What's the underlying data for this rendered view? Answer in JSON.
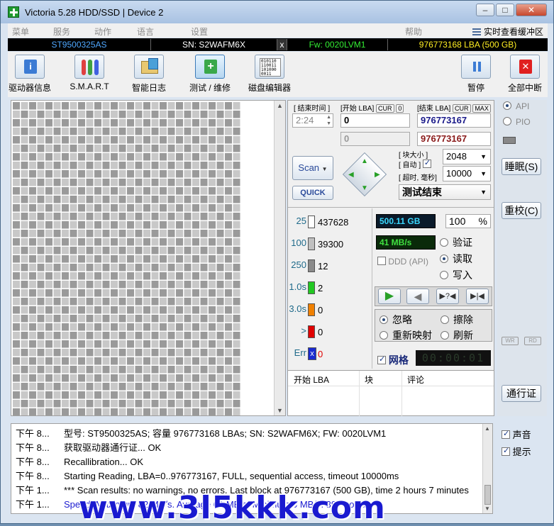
{
  "window": {
    "title": "Victoria 5.28 HDD/SSD | Device 2"
  },
  "menu": {
    "items": [
      "菜单",
      "服务",
      "动作",
      "语言",
      "设置",
      "帮助"
    ],
    "realtime_buffer": "实时查看缓冲区"
  },
  "drive": {
    "model": "ST9500325AS",
    "sn": "SN: S2WAFM6X",
    "x": "x",
    "fw": "Fw: 0020LVM1",
    "lba": "976773168 LBA (500 GB)"
  },
  "toolbar": {
    "buttons": [
      "驱动器信息",
      "S.M.A.R.T",
      "智能日志",
      "测试 / 维修",
      "磁盘编辑器"
    ],
    "pause": "暂停",
    "abort": "全部中断"
  },
  "scan": {
    "end_time_label": "[ 结束时间 ]",
    "start_lba_label": "[开始 LBA]",
    "end_lba_label": "[结束 LBA]",
    "cur": "CUR",
    "zero": "0",
    "max": "MAX",
    "end_time": "2:24",
    "start_lba": "0",
    "end_lba": "976773167",
    "cur_lba": "0",
    "cur_end_lba": "976773167",
    "scan_button": "Scan",
    "quick_button": "QUICK",
    "block_size_label": "[ 块大小 ]",
    "auto_label": "[ 自动 ]",
    "timeout_label": "[ 超时, 毫秒]",
    "block_size": "2048",
    "timeout": "10000",
    "status": "测试结束"
  },
  "stats": {
    "rows": [
      {
        "label": "25",
        "count": "437628",
        "color": "#ffffff"
      },
      {
        "label": "100",
        "count": "39300",
        "color": "#c0c0c0"
      },
      {
        "label": "250",
        "count": "12",
        "color": "#8a8a8a"
      },
      {
        "label": "1.0s",
        "count": "2",
        "color": "#22c822"
      },
      {
        "label": "3.0s",
        "count": "0",
        "color": "#f08000"
      },
      {
        "label": ">",
        "count": "0",
        "color": "#e00000"
      }
    ],
    "err_label": "Err",
    "err_count": "0",
    "size": "500.11 GB",
    "percent": "100",
    "percent_sign": "%",
    "speed": "41 MB/s",
    "ddd": "DDD (API)",
    "verify": "验证",
    "read": "读取",
    "write": "写入",
    "ignore": "忽略",
    "erase": "擦除",
    "remap": "重新映射",
    "refresh": "刷新",
    "grid": "网格",
    "timer": "00:00:01"
  },
  "table": {
    "col1": "开始 LBA",
    "col2": "块",
    "col3": "评论"
  },
  "side": {
    "api": "API",
    "pio": "PIO",
    "sleep": "睡眠(S)",
    "reset": "重校(C)",
    "wr": "WR",
    "rd": "RD",
    "passport": "通行证"
  },
  "log": {
    "rows": [
      {
        "time": "下午 8...",
        "text": "型号: ST9500325AS; 容量 976773168 LBAs; SN: S2WAFM6X; FW: 0020LVM1",
        "color": "#000000"
      },
      {
        "time": "下午 8...",
        "text": "获取驱动器通行证... OK",
        "color": "#000000"
      },
      {
        "time": "下午 8...",
        "text": "Recallibration... OK",
        "color": "#000000"
      },
      {
        "time": "下午 8...",
        "text": "Starting Reading, LBA=0..976773167, FULL, sequential access, timeout 10000ms",
        "color": "#000000"
      },
      {
        "time": "下午 1...",
        "text": "*** Scan results: no warnings, no errors. Last block at 976773167 (500 GB), time 2 hours 7 minutes",
        "color": "#000000"
      },
      {
        "time": "下午 1...",
        "text": "Speed: Maximum 82 MB/s. Average 61 MB/s. Minimum 0 MB/s. 399 points.",
        "color": "#1a1ad0"
      }
    ],
    "sound": "声音",
    "hint": "提示"
  },
  "watermark": "www.3l5kkk.com"
}
